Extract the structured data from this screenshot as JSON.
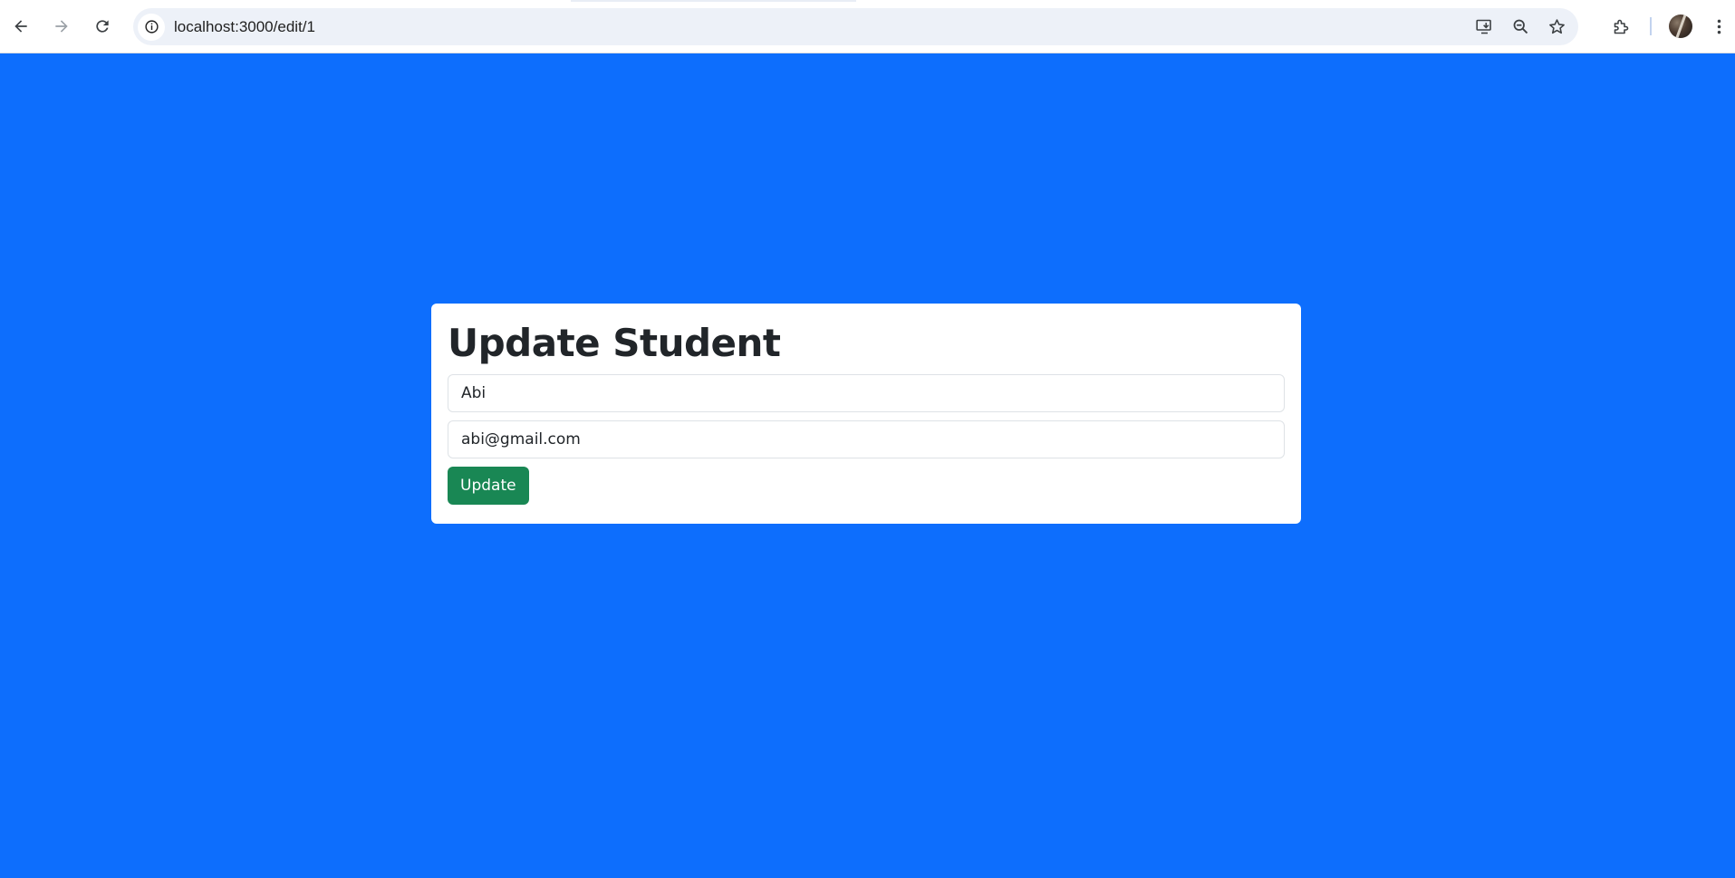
{
  "browser": {
    "url": "localhost:3000/edit/1",
    "back_icon": "arrow-left-icon",
    "forward_icon": "arrow-right-icon",
    "reload_icon": "reload-icon",
    "site_info_icon": "info-icon",
    "install_icon": "install-app-icon",
    "zoom_icon": "zoom-out-icon",
    "bookmark_icon": "star-icon",
    "extensions_icon": "puzzle-icon",
    "profile_icon": "avatar",
    "menu_icon": "more-vert-icon"
  },
  "colors": {
    "page_background": "#0d6efd",
    "card_background": "#ffffff",
    "button_background": "#198754",
    "heading_text": "#212529"
  },
  "form": {
    "title": "Update Student",
    "name_value": "Abi",
    "email_value": "abi@gmail.com",
    "submit_label": "Update"
  }
}
